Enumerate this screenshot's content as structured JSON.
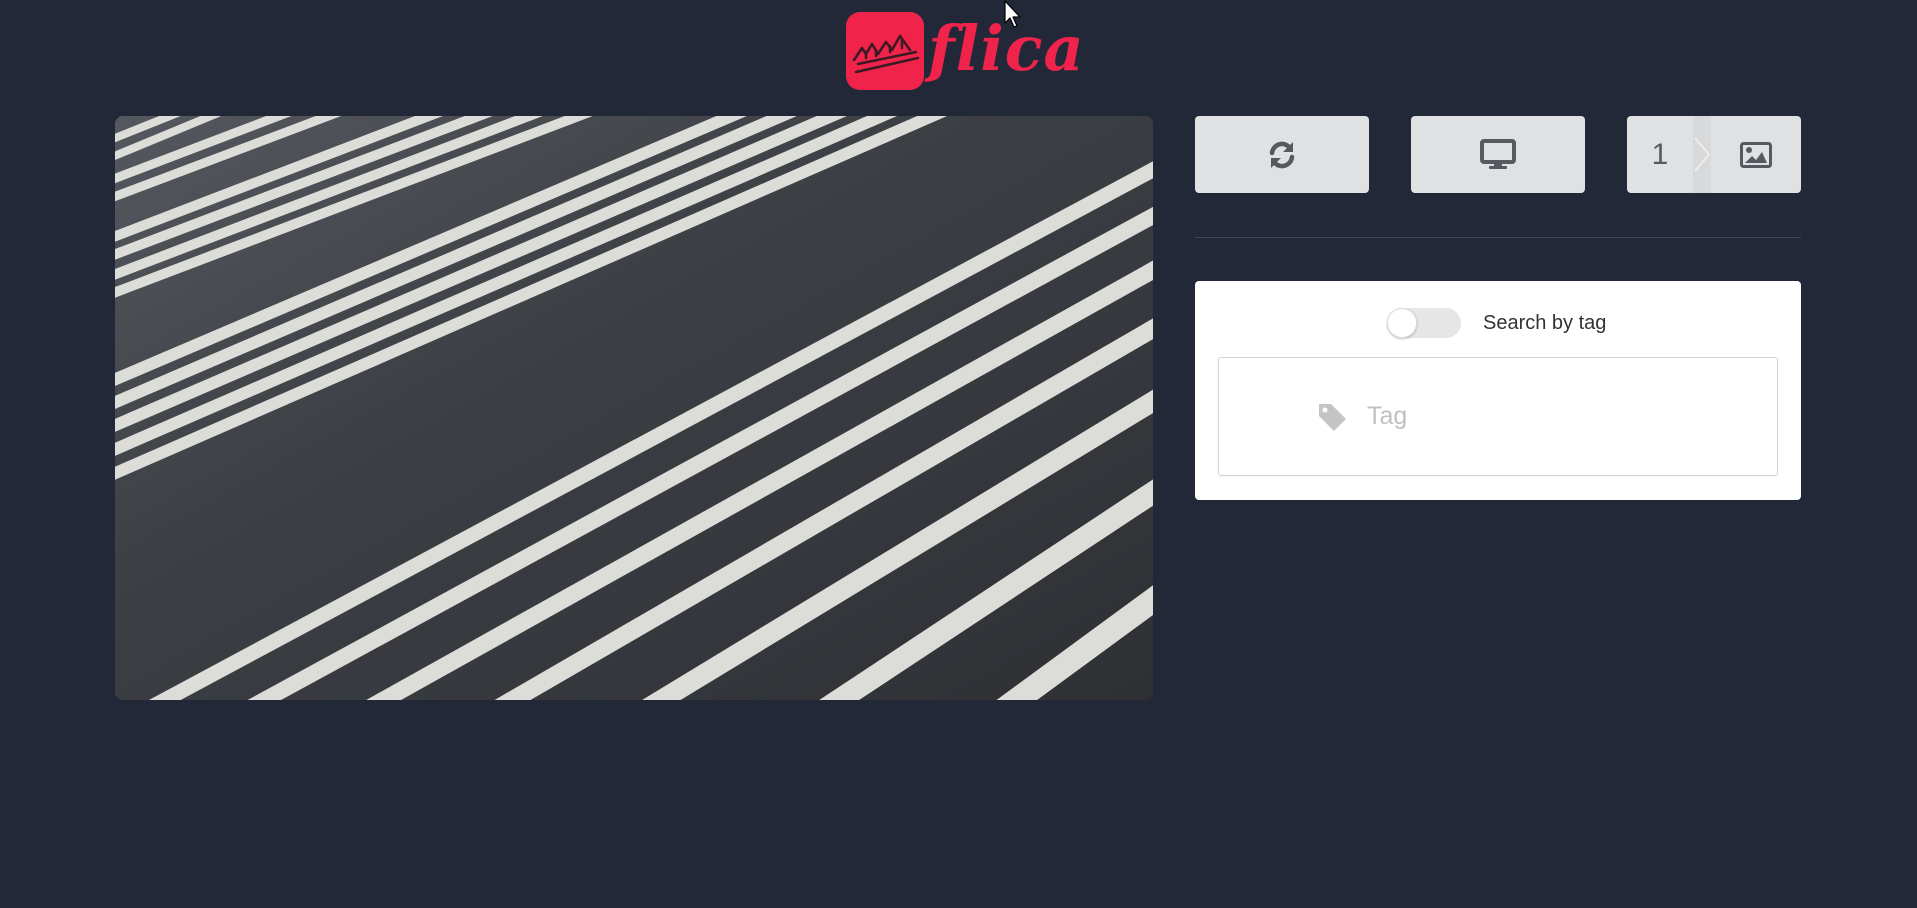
{
  "app": {
    "name": "flica",
    "brand_color": "#f0234b",
    "background_color": "#232839"
  },
  "image": {
    "description_icon": "photo-preview"
  },
  "toolbar": {
    "refresh_icon": "refresh-icon",
    "display_icon": "desktop-icon",
    "image_count": "1",
    "image_icon": "image-icon"
  },
  "search": {
    "toggle_label": "Search by tag",
    "toggle_on": false,
    "tag_placeholder": "Tag",
    "tag_icon": "tag-icon"
  }
}
